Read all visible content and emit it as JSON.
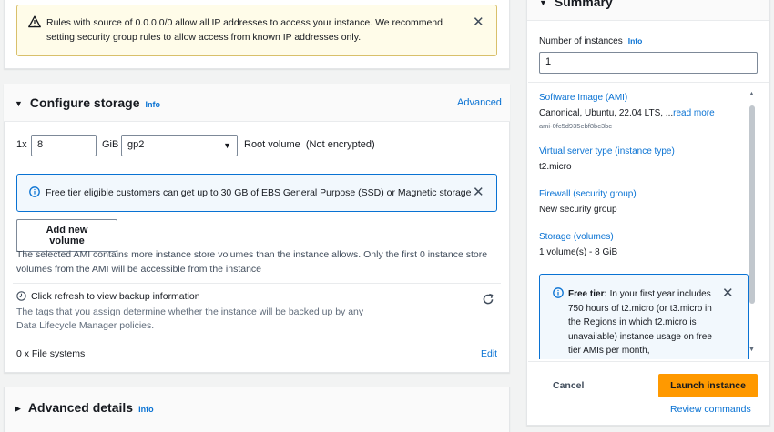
{
  "warning": {
    "text": "Rules with source of 0.0.0.0/0 allow all IP addresses to access your instance. We recommend setting security group rules to allow access from known IP addresses only.",
    "icon": "warning-icon"
  },
  "storage": {
    "title": "Configure storage",
    "info": "Info",
    "advanced": "Advanced",
    "count_prefix": "1x",
    "size_value": "8",
    "size_unit": "GiB",
    "volume_type": "gp2",
    "root_label": "Root volume  (Not encrypted)",
    "free_tier_notice": "Free tier eligible customers can get up to 30 GB of EBS General Purpose (SSD) or Magnetic storage",
    "add_volume": "Add new volume",
    "ami_note": "The selected AMI contains more instance store volumes than the instance allows. Only the first 0 instance store volumes from the AMI will be accessible from the instance",
    "backup_title": "Click refresh to view backup information",
    "backup_desc": "The tags that you assign determine whether the instance will be backed up by any Data Lifecycle Manager policies.",
    "file_systems": "0 x File systems",
    "edit": "Edit"
  },
  "advanced_details": {
    "title": "Advanced details",
    "info": "Info"
  },
  "summary": {
    "title": "Summary",
    "num_instances_label": "Number of instances",
    "num_instances_info": "Info",
    "num_instances_value": "1",
    "ami_label": "Software Image (AMI)",
    "ami_value": "Canonical, Ubuntu, 22.04 LTS, ...",
    "ami_read_more": "read more",
    "ami_id": "ami-0fc5d935ebf8bc3bc",
    "instance_type_label": "Virtual server type (instance type)",
    "instance_type_value": "t2.micro",
    "firewall_label": "Firewall (security group)",
    "firewall_value": "New security group",
    "storage_label": "Storage (volumes)",
    "storage_value": "1 volume(s) - 8 GiB",
    "free_tier_bold": "Free tier:",
    "free_tier_text": " In your first year includes 750 hours of t2.micro (or t3.micro in the Regions in which t2.micro is unavailable) instance usage on free tier AMIs per month,",
    "cancel": "Cancel",
    "launch": "Launch instance",
    "review": "Review commands"
  },
  "colors": {
    "accent": "#0972d3",
    "warning_bg": "#fffce9",
    "warning_border": "#d9c06b",
    "info_bg": "#f2f8fd",
    "primary_button": "#ff9900"
  }
}
